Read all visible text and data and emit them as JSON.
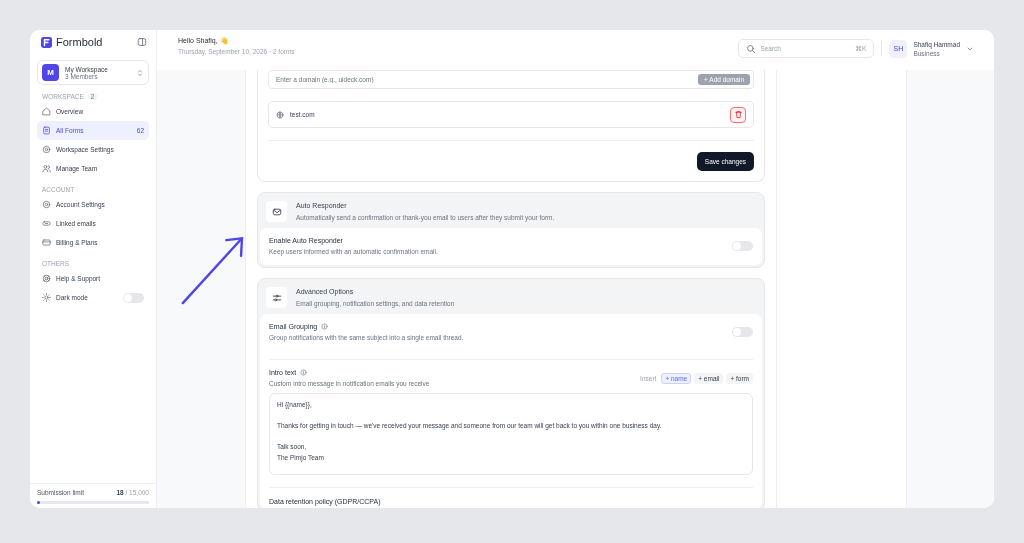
{
  "sidebar": {
    "logo": "Formbold",
    "workspace": {
      "initial": "M",
      "name": "My Workspace",
      "members": "3 Members"
    },
    "sections": [
      {
        "title": "WORKSPACE",
        "count": "2",
        "items": [
          {
            "label": "Overview",
            "kind": "link",
            "selected": false
          },
          {
            "label": "All Forms",
            "kind": "link",
            "count": "62",
            "selected": true
          },
          {
            "label": "Workspace Settings",
            "kind": "link",
            "selected": false
          },
          {
            "label": "Manage Team",
            "kind": "link",
            "selected": false
          }
        ]
      },
      {
        "title": "ACCOUNT",
        "items": [
          {
            "label": "Account Settings",
            "kind": "link",
            "selected": false
          },
          {
            "label": "Linked emails",
            "kind": "link",
            "selected": false
          },
          {
            "label": "Billing & Plans",
            "kind": "link",
            "selected": false
          }
        ]
      },
      {
        "title": "OTHERS",
        "items": [
          {
            "label": "Help & Support",
            "kind": "link",
            "selected": false
          },
          {
            "label": "Dark mode",
            "kind": "toggle",
            "on": false,
            "selected": false
          }
        ]
      }
    ],
    "usage": {
      "label": "Submission limit",
      "value": "**18** / 15,000",
      "level": 0.01
    }
  },
  "header": {
    "greeting": "Hello Shafiq, 👋",
    "subtitle": "Thursday, September 10, 2026 · 2 forms",
    "search": {
      "placeholder": "Search",
      "shortcut": "⌘K"
    },
    "user": {
      "initials": "SH",
      "name": "Shafiq Hammad",
      "plan": "Business"
    }
  },
  "domains": {
    "placeholder": "Enter a domain (e.g., uideck.com)",
    "add_button": "+ Add domain",
    "items": [
      "test.com"
    ],
    "save_button": "Save changes"
  },
  "auto_responder": {
    "title": "Auto Responder",
    "description": "Automatically send a confirmation or thank-you email to users after they submit your form.",
    "setting": {
      "label": "Enable Auto Responder",
      "description": "Keep users informed with an automatic confirmation email.",
      "on": false
    }
  },
  "advanced": {
    "title": "Advanced Options",
    "description": "Email grouping, notification settings, and data retention",
    "email_grouping": {
      "label": "Email Grouping",
      "description": "Group notifications with the same subject into a single email thread.",
      "on": false
    },
    "intro_text": {
      "label": "Intro text",
      "description": "Custom intro message in notification emails you receive",
      "insert_label": "Insert",
      "tokens": [
        {
          "label": "+ name",
          "selected": true
        },
        {
          "label": "+ email",
          "selected": false
        },
        {
          "label": "+ form",
          "selected": false
        }
      ],
      "value": "Hi {{name}},\n\nThanks for getting in touch — we've received your message and someone from our team will get back to you within one business day.\n\nTalk soon,\nThe Pimjo Team"
    },
    "retention": {
      "label": "Data retention policy (GDPR/CCPA)"
    }
  }
}
